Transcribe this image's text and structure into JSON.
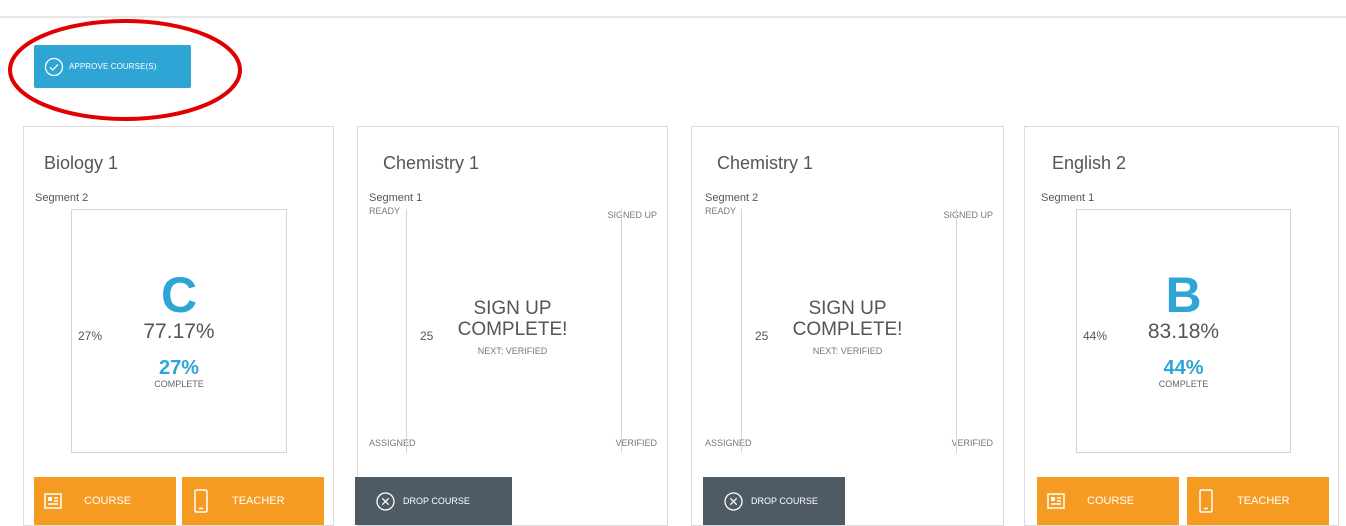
{
  "toolbar": {
    "approve_label": "APPROVE COURSE(S)"
  },
  "colors": {
    "accent_blue": "#2fa5d6",
    "accent_orange": "#f59b22",
    "dark_button": "#4e5a64",
    "annotation_red": "#e00000"
  },
  "icons": {
    "approve": "check-circle-icon",
    "course": "course-card-icon",
    "teacher": "phone-icon",
    "drop": "x-circle-icon"
  },
  "cards": [
    {
      "title": "Biology 1",
      "segment": "Segment 2",
      "grade_letter": "C",
      "grade_percent": "77.17%",
      "side_percent": "27%",
      "complete_percent": "27%",
      "complete_label": "COMPLETE",
      "course_label": "COURSE",
      "teacher_label": "TEACHER"
    },
    {
      "title": "Chemistry 1",
      "segment": "Segment 1",
      "corner_ready": "READY",
      "corner_signed_up": "SIGNED UP",
      "corner_assigned": "ASSIGNED",
      "corner_verified": "VERIFIED",
      "status_line1": "SIGN UP",
      "status_line2": "COMPLETE!",
      "next_label": "NEXT: VERIFIED",
      "count": "25",
      "drop_label": "DROP COURSE"
    },
    {
      "title": "Chemistry 1",
      "segment": "Segment 2",
      "corner_ready": "READY",
      "corner_signed_up": "SIGNED UP",
      "corner_assigned": "ASSIGNED",
      "corner_verified": "VERIFIED",
      "status_line1": "SIGN UP",
      "status_line2": "COMPLETE!",
      "next_label": "NEXT: VERIFIED",
      "count": "25",
      "drop_label": "DROP COURSE"
    },
    {
      "title": "English 2",
      "segment": "Segment 1",
      "grade_letter": "B",
      "grade_percent": "83.18%",
      "side_percent": "44%",
      "complete_percent": "44%",
      "complete_label": "COMPLETE",
      "course_label": "COURSE",
      "teacher_label": "TEACHER"
    }
  ]
}
